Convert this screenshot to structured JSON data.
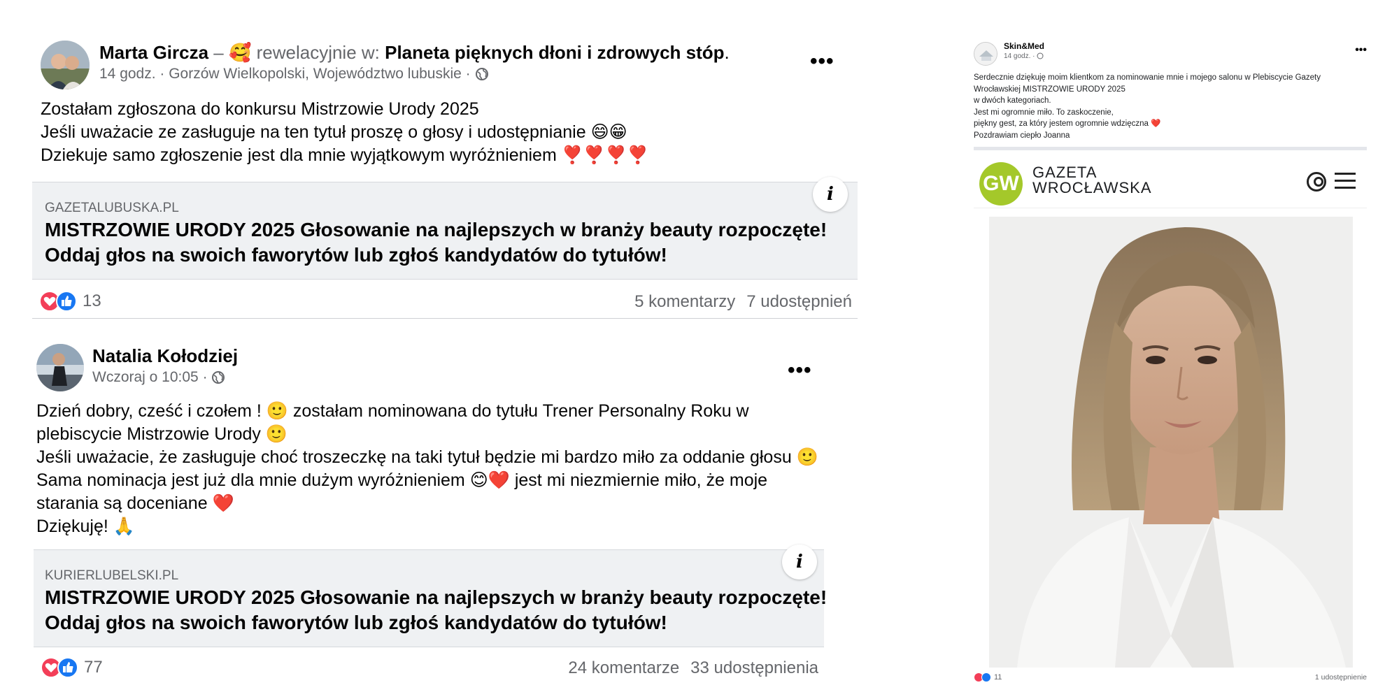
{
  "posts": [
    {
      "author": "Marta Gircza",
      "feeling_dash": " – ",
      "feeling_emoji": "🥰",
      "feeling_text": " rewelacyjnie w: ",
      "group": "Planeta pięknych dłoni i zdrowych stóp",
      "group_suffix": ".",
      "meta": "14 godz. · Gorzów Wielkopolski, Województwo lubuskie · ",
      "more_label": "•••",
      "text_lines": [
        "Zostałam zgłoszona do konkursu Mistrzowie Urody 2025",
        "Jeśli uważacie ze zasługuje na ten tytuł proszę o głosy i udostępnianie 😄😁",
        "Dziekuje samo zgłoszenie jest dla mnie wyjątkowym wyróżnieniem ❣️❣️❣️❣️"
      ],
      "link": {
        "domain": "GAZETALUBUSKA.PL",
        "title_lines": [
          "MISTRZOWIE URODY 2025 Głosowanie na najlepszych w branży beauty rozpoczęte!",
          "Oddaj głos na swoich faworytów lub zgłoś kandydatów do tytułów!"
        ],
        "info_label": "i"
      },
      "reactions_count": "13",
      "comments": "5 komentarzy",
      "shares": "7 udostępnień"
    },
    {
      "author": "Natalia Kołodziej",
      "meta": "Wczoraj o 10:05 · ",
      "more_label": "•••",
      "text_lines": [
        "Dzień dobry, cześć i czołem ! 🙂 zostałam nominowana do tytułu Trener Personalny Roku w",
        "plebiscycie Mistrzowie Urody 🙂",
        "Jeśli uważacie, że zasługuje choć troszeczkę na taki tytuł będzie mi bardzo miło za oddanie głosu 🙂",
        "Sama nominacja jest już dla mnie dużym wyróżnieniem 😊❤️ jest mi niezmiernie miło, że moje",
        "starania są doceniane ❤️",
        "Dziękuję! 🙏"
      ],
      "link": {
        "domain": "KURIERLUBELSKI.PL",
        "title_lines": [
          "MISTRZOWIE URODY 2025 Głosowanie na najlepszych w branży beauty rozpoczęte!",
          "Oddaj głos na swoich faworytów lub zgłoś kandydatów do tytułów!"
        ],
        "info_label": "i"
      },
      "reactions_count": "77",
      "comments": "24 komentarze",
      "shares": "33 udostępnienia"
    }
  ],
  "side_post": {
    "author": "Skin&Med",
    "meta": "14 godz. · ",
    "more_label": "•••",
    "text_lines": [
      "Serdecznie dziękuję moim klientkom za nominowanie mnie i mojego salonu w Plebiscycie Gazety",
      "Wrocławskiej MISTRZOWIE URODY 2025",
      "w dwóch kategoriach.",
      "Jest mi ogromnie miło. To zaskoczenie,",
      "piękny gest, za który jestem ogromnie wdzięczna ❤️",
      "Pozdrawiam ciepło Joanna"
    ],
    "gw_logo_letters": "GW",
    "gw_title_line1": "GAZETA",
    "gw_title_line2": "WROCŁAWSKA",
    "reactions_count": "11",
    "shares": "1 udostępnienie"
  },
  "colors": {
    "love": "#f33e58",
    "like": "#1877f2",
    "secondary_text": "#65676b",
    "card_bg": "#eff1f3",
    "gw_green": "#a4c82a"
  }
}
